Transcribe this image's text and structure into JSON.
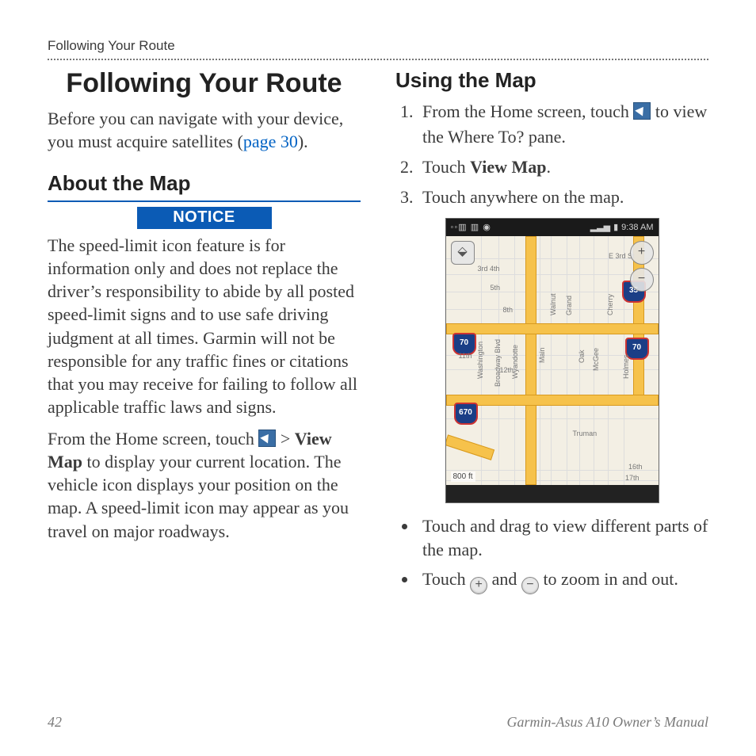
{
  "running_head": "Following Your Route",
  "title": "Following Your Route",
  "intro": {
    "before": "Before you can navigate with your device, you must acquire satellites (",
    "link": "page 30",
    "after": ")."
  },
  "about": {
    "heading": "About the Map",
    "notice_label": "NOTICE",
    "notice_body": "The speed-limit icon feature is for information only and does not replace the driver’s responsibility to abide by all posted speed-limit signs and to use safe driving judgment at all times. Garmin will not be responsible for any traffic fines or citations that you may receive for failing to follow all applicable traffic laws and signs.",
    "para_pre": "From the Home screen, touch ",
    "para_gt": " > ",
    "para_bold": "View Map",
    "para_post": " to display your current location. The vehicle icon displays your position on the map. A speed-limit icon may appear as you travel on major roadways."
  },
  "using": {
    "heading": "Using the Map",
    "steps": {
      "s1a": "From the Home screen, touch ",
      "s1b": " to view the Where To? pane.",
      "s2a": "Touch ",
      "s2b": "View Map",
      "s2c": ".",
      "s3": "Touch anywhere on the map."
    },
    "bullets": {
      "b1": "Touch and drag to view different parts of the map.",
      "b2a": "Touch ",
      "b2plus": "+",
      "b2mid": " and ",
      "b2minus": "−",
      "b2b": " to zoom in and out."
    }
  },
  "phone": {
    "status_left": "◦◦▥ ▥ ◉",
    "status_sig": "▂▃▅",
    "status_batt": "▮",
    "time": "9:38 AM",
    "shields": {
      "i35": "35",
      "i70a": "70",
      "i70b": "70",
      "i670": "670"
    },
    "scale": "800 ft",
    "streets": {
      "e3rd": "E 3rd St",
      "third4th": "3rd 4th",
      "fifth": "5th",
      "eighth": "8th",
      "eleventh": "11th",
      "twelfth": "12th",
      "sixteenth": "16th",
      "seventeenth": "17th",
      "truman": "Truman",
      "wash": "Washington",
      "bway": "Broadway Blvd",
      "wyan": "Wyandotte",
      "main": "Main",
      "walnut": "Walnut",
      "grand": "Grand",
      "oak": "Oak",
      "mcgee": "McGee",
      "cherry": "Cherry",
      "holmes": "Holmes"
    },
    "controls": {
      "compass": "⬙",
      "plus": "+",
      "minus": "−"
    }
  },
  "footer": {
    "page": "42",
    "doc": "Garmin-Asus A10 Owner’s Manual"
  }
}
